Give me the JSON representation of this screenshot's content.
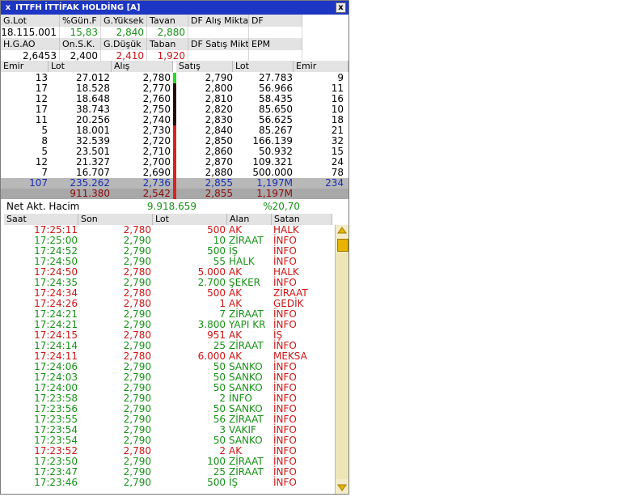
{
  "window": {
    "title": "ITTFH İTTİFAK HOLDİNG [A]",
    "close_label": "x",
    "close_button": "x"
  },
  "summary": {
    "row1_labels": [
      "G.Lot",
      "%Gün.F",
      "G.Yüksek",
      "Tavan",
      "DF Alış Miktar",
      "DF"
    ],
    "row1_values": [
      "18.115.001",
      "15,83",
      "2,840",
      "2,880",
      "",
      ""
    ],
    "row2_labels": [
      "H.G.AO",
      "On.S.K.",
      "G.Düşük",
      "Taban",
      "DF Satış Mikta",
      "EPM"
    ],
    "row2_values": [
      "2,6453",
      "2,400",
      "2,410",
      "1,920",
      "",
      ""
    ]
  },
  "orderbook": {
    "headers": [
      "Emir",
      "Lot",
      "Alış",
      "Satış",
      "Lot",
      "Emir"
    ],
    "rows": [
      [
        "13",
        "27.012",
        "2,780",
        "2,790",
        "27.783",
        "9"
      ],
      [
        "17",
        "18.528",
        "2,770",
        "2,800",
        "56.966",
        "11"
      ],
      [
        "12",
        "18.648",
        "2,760",
        "2,810",
        "58.435",
        "16"
      ],
      [
        "17",
        "38.743",
        "2,750",
        "2,820",
        "85.650",
        "10"
      ],
      [
        "11",
        "20.256",
        "2,740",
        "2,830",
        "56.625",
        "18"
      ],
      [
        "5",
        "18.001",
        "2,730",
        "2,840",
        "85.267",
        "21"
      ],
      [
        "8",
        "32.539",
        "2,720",
        "2,850",
        "166.139",
        "32"
      ],
      [
        "5",
        "23.501",
        "2,710",
        "2,860",
        "50.932",
        "15"
      ],
      [
        "12",
        "21.327",
        "2,700",
        "2,870",
        "109.321",
        "24"
      ],
      [
        "7",
        "16.707",
        "2,690",
        "2,880",
        "500.000",
        "78"
      ]
    ],
    "bar_colors": [
      "#22dd22",
      "#2a0a0a",
      "#2a0a0a",
      "#2a0a0a",
      "#2a0a0a",
      "#dd2020",
      "#dd2020",
      "#dd2020",
      "#dd2020",
      "#dd2020"
    ],
    "total_row": [
      "107",
      "235.262",
      "2,736",
      "2,855",
      "1,197M",
      "234"
    ],
    "avg_row": [
      "911.380",
      "2,542",
      "2,855",
      "1,197M"
    ]
  },
  "net": {
    "label": "Net Akt. Hacim",
    "value": "9.918.659",
    "percent": "%20,70"
  },
  "trades": {
    "headers": [
      "Saat",
      "Son",
      "Lot",
      "Alan",
      "Satan"
    ],
    "rows": [
      [
        "17:25:11",
        "2,780",
        "500",
        "AK",
        "HALK",
        "r"
      ],
      [
        "17:25:00",
        "2,790",
        "10",
        "ZİRAAT",
        "İNFO",
        "g"
      ],
      [
        "17:24:52",
        "2,790",
        "500",
        "İŞ",
        "İNFO",
        "g"
      ],
      [
        "17:24:50",
        "2,790",
        "55",
        "HALK",
        "İNFO",
        "g"
      ],
      [
        "17:24:50",
        "2,780",
        "5.000",
        "AK",
        "HALK",
        "r"
      ],
      [
        "17:24:35",
        "2,790",
        "2.700",
        "ŞEKER",
        "İNFO",
        "g"
      ],
      [
        "17:24:34",
        "2,780",
        "500",
        "AK",
        "ZİRAAT",
        "r"
      ],
      [
        "17:24:26",
        "2,780",
        "1",
        "AK",
        "GEDİK",
        "r"
      ],
      [
        "17:24:21",
        "2,790",
        "7",
        "ZİRAAT",
        "İNFO",
        "g"
      ],
      [
        "17:24:21",
        "2,790",
        "3.800",
        "YAPI KR",
        "İNFO",
        "g"
      ],
      [
        "17:24:15",
        "2,780",
        "951",
        "AK",
        "İŞ",
        "r"
      ],
      [
        "17:24:14",
        "2,790",
        "25",
        "ZİRAAT",
        "İNFO",
        "g"
      ],
      [
        "17:24:11",
        "2,780",
        "6.000",
        "AK",
        "MEKSA",
        "r"
      ],
      [
        "17:24:06",
        "2,790",
        "50",
        "SANKO",
        "İNFO",
        "g"
      ],
      [
        "17:24:03",
        "2,790",
        "50",
        "SANKO",
        "İNFO",
        "g"
      ],
      [
        "17:24:00",
        "2,790",
        "50",
        "SANKO",
        "İNFO",
        "g"
      ],
      [
        "17:23:58",
        "2,790",
        "2",
        "İNFO",
        "İNFO",
        "g"
      ],
      [
        "17:23:56",
        "2,790",
        "50",
        "SANKO",
        "İNFO",
        "g"
      ],
      [
        "17:23:55",
        "2,790",
        "56",
        "ZİRAAT",
        "İNFO",
        "g"
      ],
      [
        "17:23:54",
        "2,790",
        "3",
        "VAKIF",
        "İNFO",
        "g"
      ],
      [
        "17:23:54",
        "2,790",
        "50",
        "SANKO",
        "İNFO",
        "g"
      ],
      [
        "17:23:52",
        "2,780",
        "2",
        "AK",
        "İNFO",
        "r"
      ],
      [
        "17:23:50",
        "2,790",
        "100",
        "ZİRAAT",
        "İNFO",
        "g"
      ],
      [
        "17:23:47",
        "2,790",
        "25",
        "ZİRAAT",
        "İNFO",
        "g"
      ],
      [
        "17:23:46",
        "2,790",
        "500",
        "İŞ",
        "İNFO",
        "g"
      ]
    ]
  },
  "colors": {
    "titlebar": "#1d36c4",
    "up": "#169216",
    "down": "#d01414",
    "total_row_bg": "#b8b8b8",
    "avg_row_bg": "#a8a8a8"
  }
}
